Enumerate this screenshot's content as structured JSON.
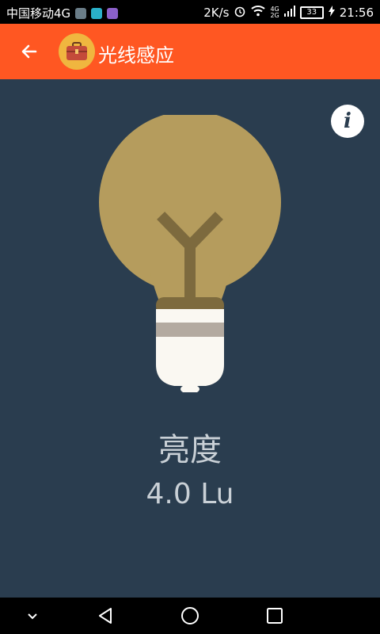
{
  "status_bar": {
    "carrier": "中国移动4G",
    "speed": "2K/s",
    "battery": "33",
    "time": "21:56",
    "icons": [
      "app-icon-1",
      "app-icon-2",
      "app-icon-3",
      "alarm-icon",
      "wifi-icon",
      "signal-icon",
      "battery-icon",
      "charging-icon"
    ],
    "signal_labels": [
      "4G",
      "2G"
    ]
  },
  "appbar": {
    "title": "光线感应",
    "back_icon": "arrow-left-icon",
    "app_icon": "toolbox-icon",
    "color": "#ff5722"
  },
  "info_button": {
    "label": "i"
  },
  "sensor": {
    "name": "亮度",
    "value": "4.0 Lu",
    "icon": "light-bulb-icon",
    "bulb_color": "#b59c5d",
    "background": "#2a3d4f"
  },
  "nav": {
    "icons": [
      "chevron-down-icon",
      "back-triangle-icon",
      "home-circle-icon",
      "recent-square-icon"
    ]
  }
}
